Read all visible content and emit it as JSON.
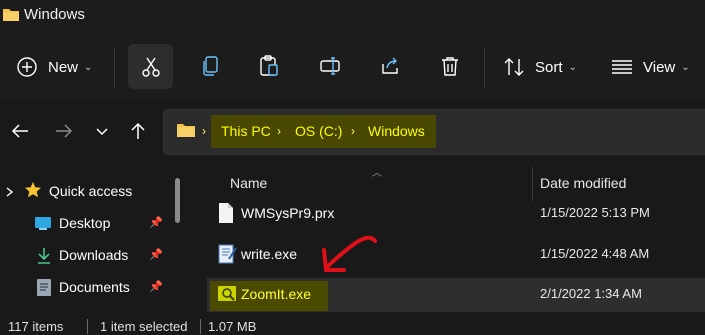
{
  "window": {
    "title": "Windows"
  },
  "toolbar": {
    "new_label": "New",
    "sort_label": "Sort",
    "view_label": "View"
  },
  "address_bar": {
    "crumbs": [
      "This PC",
      "OS (C:)",
      "Windows"
    ],
    "separator": "›"
  },
  "nav_pane": {
    "quick_access_label": "Quick access",
    "items": [
      {
        "label": "Desktop",
        "icon": "desktop-icon"
      },
      {
        "label": "Downloads",
        "icon": "download-icon"
      },
      {
        "label": "Documents",
        "icon": "documents-icon"
      }
    ]
  },
  "file_list": {
    "columns": {
      "name": "Name",
      "date_modified": "Date modified"
    },
    "rows": [
      {
        "name": "WMSysPr9.prx",
        "date": "1/15/2022 5:13 PM",
        "icon": "file-icon"
      },
      {
        "name": "write.exe",
        "date": "1/15/2022 4:48 AM",
        "icon": "wordpad-icon"
      },
      {
        "name": "ZoomIt.exe",
        "date": "2/1/2022 1:34 AM",
        "icon": "zoomit-icon",
        "selected": true
      }
    ]
  },
  "status_bar": {
    "item_count": "117 items",
    "selection": "1 item selected",
    "size": "1.07 MB"
  },
  "colors": {
    "background": "#191919",
    "highlight_text": "#ffff00",
    "highlight_bg": "#4a4a00",
    "annotation_arrow": "#e0101a"
  }
}
